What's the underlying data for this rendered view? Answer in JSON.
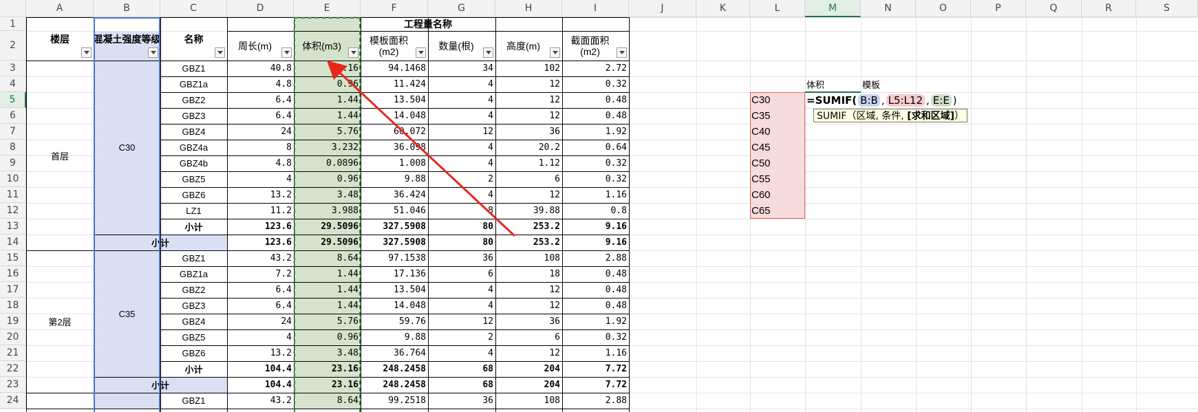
{
  "columns": [
    "A",
    "B",
    "C",
    "D",
    "E",
    "F",
    "G",
    "H",
    "I",
    "J",
    "K",
    "L",
    "M",
    "N",
    "O",
    "P",
    "Q",
    "R",
    "S"
  ],
  "selected_column": "M",
  "rows": [
    "1",
    "2",
    "3",
    "4",
    "5",
    "6",
    "7",
    "8",
    "9",
    "10",
    "11",
    "12",
    "13",
    "14",
    "15",
    "16",
    "17",
    "18",
    "19",
    "20",
    "21",
    "22",
    "23",
    "24"
  ],
  "selected_row": "5",
  "header": {
    "group_title": "工程量名称",
    "floor": "楼层",
    "grade": "混凝土强度等级",
    "name": "名称",
    "perimeter": "周长(m)",
    "volume": "体积(m3)",
    "formwork": "模板面积(m2)",
    "count": "数量(根)",
    "height": "高度(m)",
    "section": "截面面积(m2)"
  },
  "groups": [
    {
      "floor": "首层",
      "grade": "C30",
      "rows": [
        [
          "GBZ1",
          "40.8",
          "8.16",
          "94.1468",
          "34",
          "102",
          "2.72"
        ],
        [
          "GBZ1a",
          "4.8",
          "0.96",
          "11.424",
          "4",
          "12",
          "0.32"
        ],
        [
          "GBZ2",
          "6.4",
          "1.44",
          "13.504",
          "4",
          "12",
          "0.48"
        ],
        [
          "GBZ3",
          "6.4",
          "1.44",
          "14.048",
          "4",
          "12",
          "0.48"
        ],
        [
          "GBZ4",
          "24",
          "5.76",
          "60.072",
          "12",
          "36",
          "1.92"
        ],
        [
          "GBZ4a",
          "8",
          "3.232",
          "36.098",
          "4",
          "20.2",
          "0.64"
        ],
        [
          "GBZ4b",
          "4.8",
          "0.0896",
          "1.008",
          "4",
          "1.12",
          "0.32"
        ],
        [
          "GBZ5",
          "4",
          "0.96",
          "9.88",
          "2",
          "6",
          "0.32"
        ],
        [
          "GBZ6",
          "13.2",
          "3.48",
          "36.424",
          "4",
          "12",
          "1.16"
        ],
        [
          "LZ1",
          "11.2",
          "3.988",
          "51.046",
          "8",
          "39.88",
          "0.8"
        ]
      ],
      "subtotal": [
        "小计",
        "123.6",
        "29.5096",
        "327.5908",
        "80",
        "253.2",
        "9.16"
      ],
      "total": [
        "小计",
        "123.6",
        "29.5096",
        "327.5908",
        "80",
        "253.2",
        "9.16"
      ]
    },
    {
      "floor": "第2层",
      "grade": "C35",
      "rows": [
        [
          "GBZ1",
          "43.2",
          "8.64",
          "97.1538",
          "36",
          "108",
          "2.88"
        ],
        [
          "GBZ1a",
          "7.2",
          "1.44",
          "17.136",
          "6",
          "18",
          "0.48"
        ],
        [
          "GBZ2",
          "6.4",
          "1.44",
          "13.504",
          "4",
          "12",
          "0.48"
        ],
        [
          "GBZ3",
          "6.4",
          "1.44",
          "14.048",
          "4",
          "12",
          "0.48"
        ],
        [
          "GBZ4",
          "24",
          "5.76",
          "59.76",
          "12",
          "36",
          "1.92"
        ],
        [
          "GBZ5",
          "4",
          "0.96",
          "9.88",
          "2",
          "6",
          "0.32"
        ],
        [
          "GBZ6",
          "13.2",
          "3.48",
          "36.764",
          "4",
          "12",
          "1.16"
        ]
      ],
      "subtotal": [
        "小计",
        "104.4",
        "23.16",
        "248.2458",
        "68",
        "204",
        "7.72"
      ],
      "total": [
        "小计",
        "104.4",
        "23.16",
        "248.2458",
        "68",
        "204",
        "7.72"
      ]
    },
    {
      "floor": "",
      "grade": "",
      "rows": [
        [
          "GBZ1",
          "43.2",
          "8.64",
          "99.2518",
          "36",
          "108",
          "2.88"
        ]
      ]
    }
  ],
  "summary": {
    "label_volume": "体积",
    "label_formwork": "模板",
    "grades": [
      "C30",
      "C35",
      "C40",
      "C45",
      "C50",
      "C55",
      "C60",
      "C65"
    ]
  },
  "formula": {
    "prefix": "=SUMIF(",
    "arg1": "B:B",
    "sep1": ",",
    "arg2": "L5:L12",
    "sep2": ",",
    "arg3": "E:E",
    "suffix": ")"
  },
  "tooltip": {
    "fn": "SUMIF",
    "args": "（区域, 条件, ",
    "bold_arg": "[求和区域]",
    "close": "）"
  },
  "colors": {
    "grade_fill": "#dae0f4",
    "volume_fill": "#d5e3cc",
    "criteria_fill": "#f8dcdc",
    "arrow": "#e8261d",
    "selection": "#217346"
  }
}
